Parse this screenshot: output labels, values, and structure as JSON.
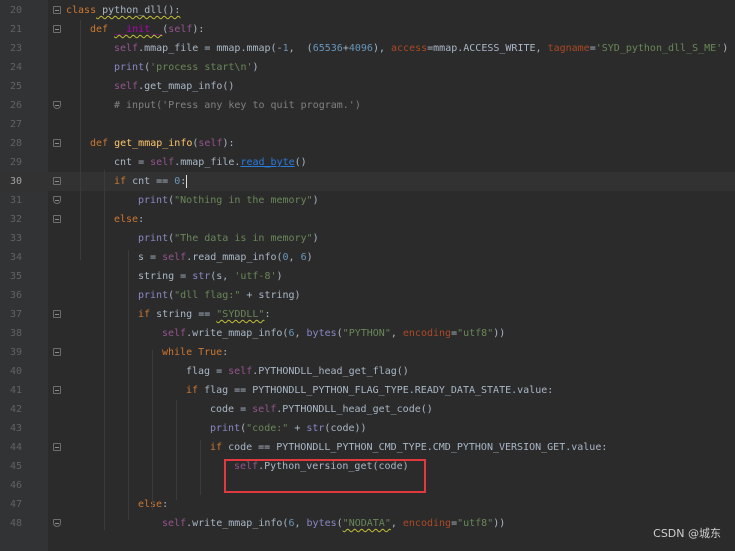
{
  "editor": {
    "lines": [
      {
        "num": "20",
        "segments": [
          {
            "t": "class",
            "c": "kw"
          },
          {
            "t": " python_dll():",
            "c": "wavy"
          }
        ]
      },
      {
        "num": "21",
        "segments": [
          {
            "t": "def ",
            "c": "kw"
          },
          {
            "t": "__init__",
            "c": "magic wavy"
          },
          {
            "t": "(",
            "c": ""
          },
          {
            "t": "self",
            "c": "sf"
          },
          {
            "t": "):",
            "c": ""
          }
        ]
      },
      {
        "num": "23",
        "segments": [
          {
            "t": "self",
            "c": "sf"
          },
          {
            "t": ".mmap_file = mmap.mmap(-",
            "c": ""
          },
          {
            "t": "1",
            "c": "num"
          },
          {
            "t": ",  (",
            "c": ""
          },
          {
            "t": "65536",
            "c": "num"
          },
          {
            "t": "+",
            "c": ""
          },
          {
            "t": "4096",
            "c": "num"
          },
          {
            "t": "), ",
            "c": ""
          },
          {
            "t": "access",
            "c": "kwarg"
          },
          {
            "t": "=mmap.ACCESS_WRITE, ",
            "c": ""
          },
          {
            "t": "tagname",
            "c": "kwarg"
          },
          {
            "t": "=",
            "c": ""
          },
          {
            "t": "'SYD_python_dll_S_ME'",
            "c": "str"
          },
          {
            "t": ")",
            "c": ""
          }
        ]
      },
      {
        "num": "24",
        "segments": [
          {
            "t": "print",
            "c": "bi"
          },
          {
            "t": "(",
            "c": ""
          },
          {
            "t": "'process start\\n'",
            "c": "str"
          },
          {
            "t": ")",
            "c": ""
          }
        ]
      },
      {
        "num": "25",
        "segments": [
          {
            "t": "self",
            "c": "sf"
          },
          {
            "t": ".get_mmap_info()",
            "c": ""
          }
        ]
      },
      {
        "num": "26",
        "segments": [
          {
            "t": "# input('Press any key to quit program.')",
            "c": "cmt"
          }
        ]
      },
      {
        "num": "27",
        "segments": []
      },
      {
        "num": "28",
        "segments": [
          {
            "t": "def ",
            "c": "kw"
          },
          {
            "t": "get_mmap_info",
            "c": "fn"
          },
          {
            "t": "(",
            "c": ""
          },
          {
            "t": "self",
            "c": "sf"
          },
          {
            "t": "):",
            "c": ""
          }
        ]
      },
      {
        "num": "29",
        "segments": [
          {
            "t": "cnt = ",
            "c": ""
          },
          {
            "t": "self",
            "c": "sf"
          },
          {
            "t": ".mmap_file.",
            "c": ""
          },
          {
            "t": "read_byte",
            "c": "link"
          },
          {
            "t": "()",
            "c": ""
          }
        ]
      },
      {
        "num": "30",
        "segments": [
          {
            "t": "if ",
            "c": "kw"
          },
          {
            "t": "cnt == ",
            "c": ""
          },
          {
            "t": "0",
            "c": "num"
          },
          {
            "t": ":",
            "c": ""
          }
        ]
      },
      {
        "num": "31",
        "segments": [
          {
            "t": "print",
            "c": "bi"
          },
          {
            "t": "(",
            "c": ""
          },
          {
            "t": "\"Nothing in the memory\"",
            "c": "str"
          },
          {
            "t": ")",
            "c": ""
          }
        ]
      },
      {
        "num": "32",
        "segments": [
          {
            "t": "else",
            "c": "kw"
          },
          {
            "t": ":",
            "c": ""
          }
        ]
      },
      {
        "num": "33",
        "segments": [
          {
            "t": "print",
            "c": "bi"
          },
          {
            "t": "(",
            "c": ""
          },
          {
            "t": "\"The data is in memory\"",
            "c": "str"
          },
          {
            "t": ")",
            "c": ""
          }
        ]
      },
      {
        "num": "34",
        "segments": [
          {
            "t": "s = ",
            "c": ""
          },
          {
            "t": "self",
            "c": "sf"
          },
          {
            "t": ".read_mmap_info(",
            "c": ""
          },
          {
            "t": "0",
            "c": "num"
          },
          {
            "t": ", ",
            "c": ""
          },
          {
            "t": "6",
            "c": "num"
          },
          {
            "t": ")",
            "c": ""
          }
        ]
      },
      {
        "num": "35",
        "segments": [
          {
            "t": "string = ",
            "c": ""
          },
          {
            "t": "str",
            "c": "bi"
          },
          {
            "t": "(s, ",
            "c": ""
          },
          {
            "t": "'utf-8'",
            "c": "str"
          },
          {
            "t": ")",
            "c": ""
          }
        ]
      },
      {
        "num": "36",
        "segments": [
          {
            "t": "print",
            "c": "bi"
          },
          {
            "t": "(",
            "c": ""
          },
          {
            "t": "\"dll flag:\"",
            "c": "str"
          },
          {
            "t": " + string)",
            "c": ""
          }
        ]
      },
      {
        "num": "37",
        "segments": [
          {
            "t": "if ",
            "c": "kw"
          },
          {
            "t": "string == ",
            "c": ""
          },
          {
            "t": "\"SYDDLL\"",
            "c": "str wavy"
          },
          {
            "t": ":",
            "c": ""
          }
        ]
      },
      {
        "num": "38",
        "segments": [
          {
            "t": "self",
            "c": "sf"
          },
          {
            "t": ".write_mmap_info(",
            "c": ""
          },
          {
            "t": "6",
            "c": "num"
          },
          {
            "t": ", ",
            "c": ""
          },
          {
            "t": "bytes",
            "c": "bi"
          },
          {
            "t": "(",
            "c": ""
          },
          {
            "t": "\"PYTHON\"",
            "c": "str"
          },
          {
            "t": ", ",
            "c": ""
          },
          {
            "t": "encoding",
            "c": "kwarg"
          },
          {
            "t": "=",
            "c": ""
          },
          {
            "t": "\"utf8\"",
            "c": "str"
          },
          {
            "t": "))",
            "c": ""
          }
        ]
      },
      {
        "num": "39",
        "segments": [
          {
            "t": "while ",
            "c": "kw"
          },
          {
            "t": "True",
            "c": "kw"
          },
          {
            "t": ":",
            "c": ""
          }
        ]
      },
      {
        "num": "40",
        "segments": [
          {
            "t": "flag = ",
            "c": ""
          },
          {
            "t": "self",
            "c": "sf"
          },
          {
            "t": ".PYTHONDLL_head_get_flag()",
            "c": ""
          }
        ]
      },
      {
        "num": "41",
        "segments": [
          {
            "t": "if ",
            "c": "kw"
          },
          {
            "t": "flag == PYTHONDLL_PYTHON_FLAG_TYPE.READY_DATA_STATE.value:",
            "c": ""
          }
        ]
      },
      {
        "num": "42",
        "segments": [
          {
            "t": "code = ",
            "c": ""
          },
          {
            "t": "self",
            "c": "sf"
          },
          {
            "t": ".PYTHONDLL_head_get_code()",
            "c": ""
          }
        ]
      },
      {
        "num": "43",
        "segments": [
          {
            "t": "print",
            "c": "bi"
          },
          {
            "t": "(",
            "c": ""
          },
          {
            "t": "\"code:\"",
            "c": "str"
          },
          {
            "t": " + ",
            "c": ""
          },
          {
            "t": "str",
            "c": "bi"
          },
          {
            "t": "(code))",
            "c": ""
          }
        ]
      },
      {
        "num": "44",
        "segments": [
          {
            "t": "if ",
            "c": "kw"
          },
          {
            "t": "code == PYTHONDLL_PYTHON_CMD_TYPE.CMD_PYTHON_VERSION_GET.value:",
            "c": ""
          }
        ]
      },
      {
        "num": "45",
        "segments": [
          {
            "t": "self",
            "c": "sf"
          },
          {
            "t": ".Python_version_get(code)",
            "c": ""
          }
        ]
      },
      {
        "num": "46",
        "segments": []
      },
      {
        "num": "47",
        "segments": [
          {
            "t": "else",
            "c": "kw"
          },
          {
            "t": ":",
            "c": ""
          }
        ]
      },
      {
        "num": "48",
        "segments": [
          {
            "t": "self",
            "c": "sf"
          },
          {
            "t": ".write_mmap_info(",
            "c": ""
          },
          {
            "t": "6",
            "c": "num"
          },
          {
            "t": ", ",
            "c": ""
          },
          {
            "t": "bytes",
            "c": "bi"
          },
          {
            "t": "(",
            "c": ""
          },
          {
            "t": "\"NODATA\"",
            "c": "str wavy"
          },
          {
            "t": ", ",
            "c": ""
          },
          {
            "t": "encoding",
            "c": "kwarg"
          },
          {
            "t": "=",
            "c": ""
          },
          {
            "t": "\"utf8\"",
            "c": "str"
          },
          {
            "t": "))",
            "c": ""
          }
        ]
      }
    ],
    "current_line": "30"
  },
  "watermark": "CSDN @城东"
}
